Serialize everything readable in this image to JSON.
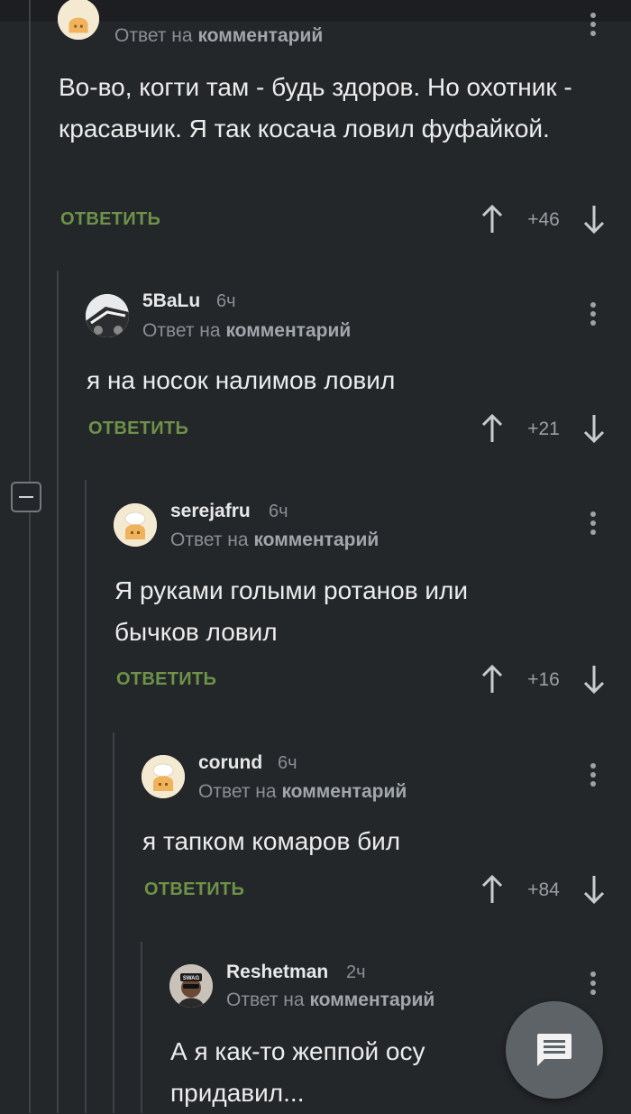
{
  "comments": [
    {
      "author": "",
      "time": "",
      "reply_prefix": "Ответ на",
      "reply_link": "комментарий",
      "text": "Во-во, когти там - будь здоров. Но охотник - красавчик. Я так косача ловил фуфайкой.",
      "reply_label": "ОТВЕТИТЬ",
      "rating": "+46"
    },
    {
      "author": "5BaLu",
      "time": "6ч",
      "reply_prefix": "Ответ на",
      "reply_link": "комментарий",
      "text": "я на носок налимов ловил",
      "reply_label": "ОТВЕТИТЬ",
      "rating": "+21"
    },
    {
      "author": "serejafru",
      "time": "6ч",
      "reply_prefix": "Ответ на",
      "reply_link": "комментарий",
      "text": "Я руками голыми ротанов или бычков ловил",
      "reply_label": "ОТВЕТИТЬ",
      "rating": "+16"
    },
    {
      "author": "corund",
      "time": "6ч",
      "reply_prefix": "Ответ на",
      "reply_link": "комментарий",
      "text": "я тапком комаров бил",
      "reply_label": "ОТВЕТИТЬ",
      "rating": "+84"
    },
    {
      "author": "Reshetman",
      "time": "2ч",
      "reply_prefix": "Ответ на",
      "reply_link": "комментарий",
      "text": "А я как-то жеппой осу придавил...",
      "reply_label": "",
      "rating": ""
    }
  ],
  "avatar_text": {
    "swag": "SWAG"
  },
  "icons": {
    "upvote": "arrow-up-icon",
    "downvote": "arrow-down-icon",
    "menu": "more-vertical-icon",
    "collapse": "minus-icon",
    "fab": "comment-icon"
  },
  "colors": {
    "background": "#24272a",
    "reply_accent": "#6d9248",
    "muted": "#8a8f94",
    "thread_line": "#3e4247",
    "fab": "#5e6367"
  }
}
